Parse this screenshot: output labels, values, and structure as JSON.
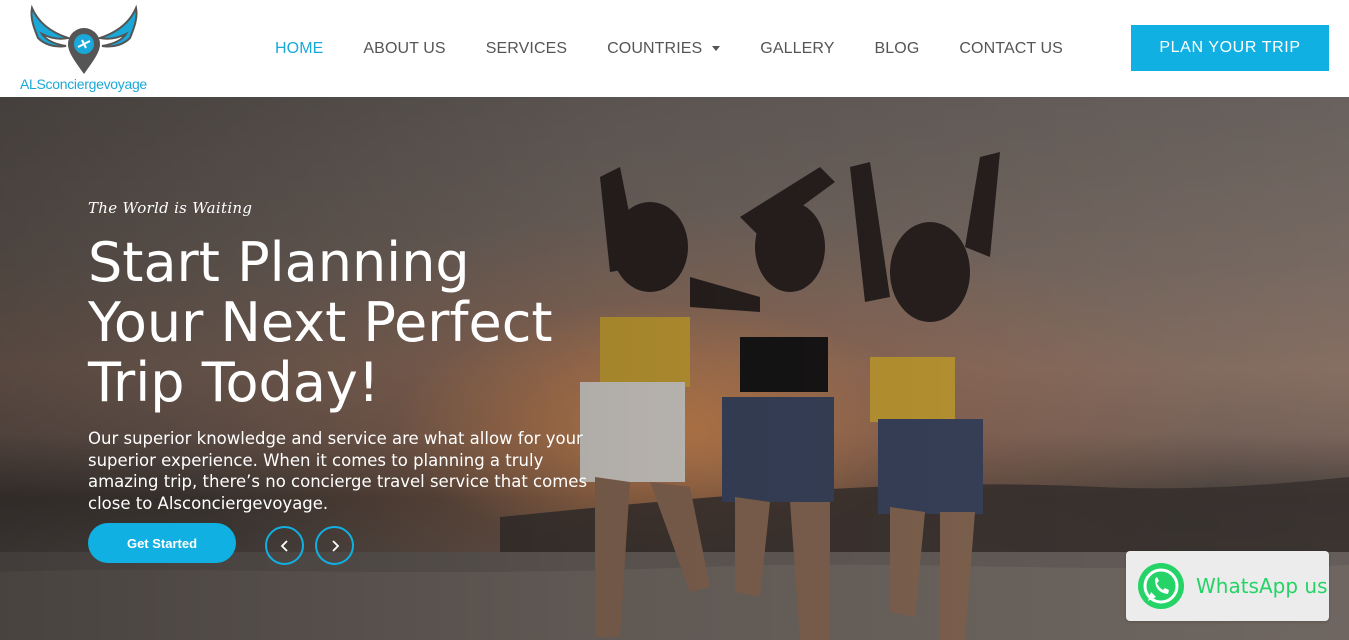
{
  "brand": {
    "logo_text": "ALSconciergevoyage",
    "accent_color": "#11b0e2"
  },
  "nav": {
    "items": [
      {
        "label": "HOME",
        "active": true
      },
      {
        "label": "ABOUT US"
      },
      {
        "label": "SERVICES"
      },
      {
        "label": "COUNTRIES",
        "dropdown": true
      },
      {
        "label": "GALLERY"
      },
      {
        "label": "BLOG"
      },
      {
        "label": "CONTACT US"
      }
    ],
    "cta_label": "PLAN YOUR TRIP"
  },
  "hero": {
    "tagline": "The World is Waiting",
    "headline_line1": "Start Planning",
    "headline_line2": "Your Next Perfect",
    "headline_line3": "Trip Today!",
    "description": "Our superior knowledge and service are what allow for your superior experience. When it comes to planning a truly amazing trip, there’s no concierge travel service that comes close to Alsconciergevoyage.",
    "button_label": "Get Started",
    "prev_icon": "chevron-left-icon",
    "next_icon": "chevron-right-icon"
  },
  "whatsapp": {
    "label": "WhatsApp us",
    "icon": "whatsapp-icon",
    "color": "#25d366"
  }
}
